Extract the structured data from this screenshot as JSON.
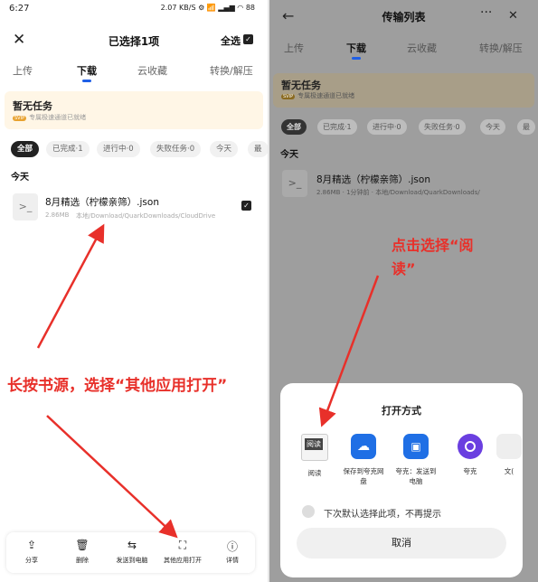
{
  "left": {
    "status": {
      "time": "6:27",
      "right": "2.07 KB/S ⚙ 📶 ▂▄▆ ◠ 88"
    },
    "header": {
      "title": "已选择1项",
      "select_all": "全选"
    },
    "tabs": [
      "上传",
      "下载",
      "云收藏",
      "转换/解压"
    ],
    "banner": {
      "title": "暂无任务",
      "badge": "SVIP",
      "subtitle": "专属极速通道已就绪"
    },
    "filters": [
      "全部",
      "已完成·1",
      "进行中·0",
      "失败任务·0",
      "今天",
      "最"
    ],
    "section": "今天",
    "file": {
      "name": "8月精选（柠檬亲筛）.json",
      "size": "2.86MB",
      "path": "本地/Download/QuarkDownloads/CloudDrive"
    },
    "annotation": "长按书源，选择“其他应用打开”",
    "actions": [
      {
        "icon": "share-icon",
        "glyph": "⇪",
        "label": "分享"
      },
      {
        "icon": "delete-icon",
        "glyph": "🗑",
        "label": "删除"
      },
      {
        "icon": "send-to-pc-icon",
        "glyph": "⇆",
        "label": "发送到电脑"
      },
      {
        "icon": "open-with-icon",
        "glyph": "⛶",
        "label": "其他应用打开"
      },
      {
        "icon": "info-icon",
        "glyph": "ⓘ",
        "label": "详情"
      }
    ]
  },
  "right": {
    "header": {
      "title": "传输列表"
    },
    "tabs": [
      "上传",
      "下载",
      "云收藏",
      "转换/解压"
    ],
    "banner": {
      "title": "暂无任务",
      "badge": "SVIP",
      "subtitle": "专属极速通道已就绪"
    },
    "filters": [
      "全部",
      "已完成·1",
      "进行中·0",
      "失败任务·0",
      "今天",
      "最"
    ],
    "section": "今天",
    "file": {
      "name": "8月精选（柠檬亲筛）.json",
      "meta": "2.86MB · 1分钟前 · 本地/Download/QuarkDownloads/"
    },
    "annotation_line1": "点击选择“阅",
    "annotation_line2": "读”",
    "sheet": {
      "title": "打开方式",
      "apps": [
        {
          "icon": "reader-app-icon",
          "label": "阅读",
          "color": "#333333"
        },
        {
          "icon": "save-cloud-icon",
          "label": "保存到夸克网盘",
          "color": "#1f6fe5"
        },
        {
          "icon": "quark-send-pc-icon",
          "label": "夸克：发送到电脑",
          "color": "#1f6fe5"
        },
        {
          "icon": "quark-app-icon",
          "label": "夸克",
          "color": "#6a3fe0"
        },
        {
          "icon": "more-app-icon",
          "label": "文(",
          "color": "#dddddd"
        }
      ],
      "default_label": "下次默认选择此项，不再提示",
      "cancel": "取消"
    }
  },
  "colors": {
    "accent": "#1f5fe6",
    "annotation": "#e8302a"
  }
}
